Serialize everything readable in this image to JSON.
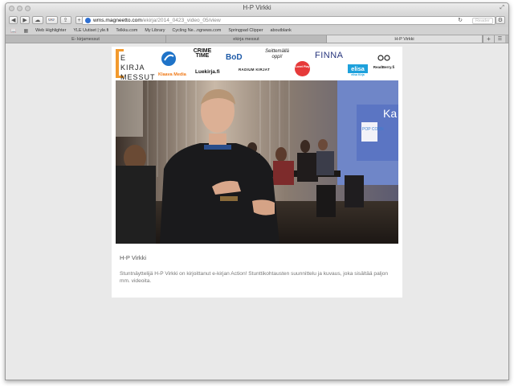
{
  "window": {
    "title": "H-P Virkki"
  },
  "toolbar": {
    "url_domain": "wms.magneetto.com",
    "url_path": "/ekirja/2014_0423_video_05/view",
    "reader_label": "Reader"
  },
  "bookmarks": [
    "Web Highlighter",
    "YLE Uutiset | yle.fi",
    "Telkku.com",
    "My Library",
    "Cycling Ne...ngnews.com",
    "Springpad Clipper",
    "aboutblank"
  ],
  "tabs": [
    {
      "label": "E- kirjamessut",
      "active": false
    },
    {
      "label": "ekirja messut",
      "active": false
    },
    {
      "label": "H-P Virkki",
      "active": true
    }
  ],
  "page": {
    "logos": {
      "ekirjamessut": "E KIRJA MESSUT",
      "klaava": "Klaava Media",
      "crime": "CRIME TIME",
      "luekirja": "Luekirja.fi",
      "bod": "BoD",
      "seittemalla": "Seittemällä oppi!",
      "radium": "RADIUM KIRJAT",
      "lovelay": "Lovel Play",
      "finna": "FINNA",
      "elisa": "elisa",
      "elisa_sub": "elisa Kirja",
      "readberry": "ReadBerry.fi"
    },
    "video": {
      "screen_word": "Ka",
      "popcorn": "POP CORN"
    },
    "title": "H-P Virkki",
    "description": "Stuntnäyttelijä H-P Virkki on kirjoittanut e-kirjan Action! Stunttikohtausten suunnittelu ja kuvaus, joka sisältää paljon mm. videoita."
  }
}
